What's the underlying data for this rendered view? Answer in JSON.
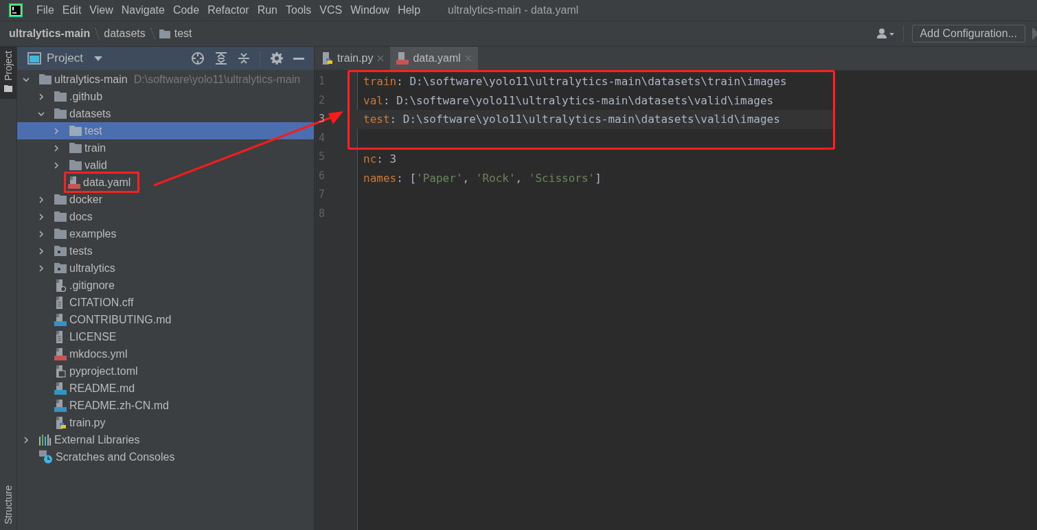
{
  "menu": [
    "File",
    "Edit",
    "View",
    "Navigate",
    "Code",
    "Refactor",
    "Run",
    "Tools",
    "VCS",
    "Window",
    "Help"
  ],
  "window": {
    "title": "ultralytics-main - data.yaml"
  },
  "breadcrumb": [
    {
      "label": "ultralytics-main",
      "kind": "project"
    },
    {
      "label": "datasets",
      "kind": "plain"
    },
    {
      "label": "test",
      "kind": "folder"
    }
  ],
  "toolbar": {
    "run_config": "Add Configuration..."
  },
  "side_tabs": [
    {
      "label": "Project",
      "selected": true
    },
    {
      "label": "Structure",
      "selected": false
    }
  ],
  "project_panel": {
    "title": "Project",
    "tree": [
      {
        "label": "ultralytics-main",
        "hint": "D:\\software\\yolo11\\ultralytics-main",
        "kind": "folder",
        "expanded": true,
        "selected": false,
        "children": [
          {
            "label": ".github",
            "kind": "folder",
            "expanded": false,
            "selected": false
          },
          {
            "label": "datasets",
            "kind": "folder",
            "expanded": true,
            "selected": false,
            "children": [
              {
                "label": "test",
                "kind": "folder",
                "expanded": false,
                "selected": true
              },
              {
                "label": "train",
                "kind": "folder",
                "expanded": false,
                "selected": false
              },
              {
                "label": "valid",
                "kind": "folder",
                "expanded": false,
                "selected": false
              },
              {
                "label": "data.yaml",
                "kind": "yaml",
                "selected": false,
                "outlined": true
              }
            ]
          },
          {
            "label": "docker",
            "kind": "folder",
            "expanded": false,
            "selected": false
          },
          {
            "label": "docs",
            "kind": "folder",
            "expanded": false,
            "selected": false
          },
          {
            "label": "examples",
            "kind": "folder",
            "expanded": false,
            "selected": false
          },
          {
            "label": "tests",
            "kind": "module",
            "expanded": false,
            "selected": false
          },
          {
            "label": "ultralytics",
            "kind": "module",
            "expanded": false,
            "selected": false
          },
          {
            "label": ".gitignore",
            "kind": "ignore",
            "selected": false
          },
          {
            "label": "CITATION.cff",
            "kind": "text",
            "selected": false
          },
          {
            "label": "CONTRIBUTING.md",
            "kind": "md",
            "selected": false
          },
          {
            "label": "LICENSE",
            "kind": "text",
            "selected": false
          },
          {
            "label": "mkdocs.yml",
            "kind": "yaml",
            "selected": false
          },
          {
            "label": "pyproject.toml",
            "kind": "toml",
            "selected": false
          },
          {
            "label": "README.md",
            "kind": "md",
            "selected": false
          },
          {
            "label": "README.zh-CN.md",
            "kind": "md",
            "selected": false
          },
          {
            "label": "train.py",
            "kind": "python",
            "selected": false
          }
        ]
      },
      {
        "label": "External Libraries",
        "kind": "libraries",
        "expanded": false,
        "selected": false
      },
      {
        "label": "Scratches and Consoles",
        "kind": "scratches",
        "selected": false
      }
    ]
  },
  "editor": {
    "tabs": [
      {
        "label": "train.py",
        "kind": "python",
        "selected": false
      },
      {
        "label": "data.yaml",
        "kind": "yaml",
        "selected": true
      }
    ],
    "lines": [
      {
        "number": "1",
        "boxed": true,
        "current": false,
        "tokens": [
          {
            "kind": "key",
            "text": "train"
          },
          {
            "kind": "plain",
            "text": ": D:\\software\\yolo11\\ultralytics-main\\datasets\\train\\images"
          }
        ]
      },
      {
        "number": "2",
        "boxed": true,
        "current": false,
        "tokens": [
          {
            "kind": "key",
            "text": "val"
          },
          {
            "kind": "plain",
            "text": ": D:\\software\\yolo11\\ultralytics-main\\datasets\\valid\\images"
          }
        ]
      },
      {
        "number": "3",
        "boxed": true,
        "current": true,
        "tokens": [
          {
            "kind": "key",
            "text": "test"
          },
          {
            "kind": "plain",
            "text": ": D:\\software\\yolo11\\ultralytics-main\\datasets\\valid\\images"
          }
        ]
      },
      {
        "number": "4",
        "boxed": true,
        "current": false
      },
      {
        "number": "5",
        "boxed": false,
        "current": false,
        "tokens": [
          {
            "kind": "key",
            "text": "nc"
          },
          {
            "kind": "plain",
            "text": ": 3"
          }
        ]
      },
      {
        "number": "6",
        "boxed": false,
        "current": false,
        "tokens": [
          {
            "kind": "key",
            "text": "names"
          },
          {
            "kind": "plain",
            "text": ": ["
          },
          {
            "kind": "string",
            "text": "'Paper'"
          },
          {
            "kind": "plain",
            "text": ", "
          },
          {
            "kind": "string",
            "text": "'Rock'"
          },
          {
            "kind": "plain",
            "text": ", "
          },
          {
            "kind": "string",
            "text": "'Scissors'"
          },
          {
            "kind": "plain",
            "text": "]"
          }
        ]
      },
      {
        "number": "7",
        "boxed": false,
        "current": false
      },
      {
        "number": "8",
        "boxed": false,
        "current": false
      }
    ]
  },
  "annotation": {
    "arrow": true
  }
}
